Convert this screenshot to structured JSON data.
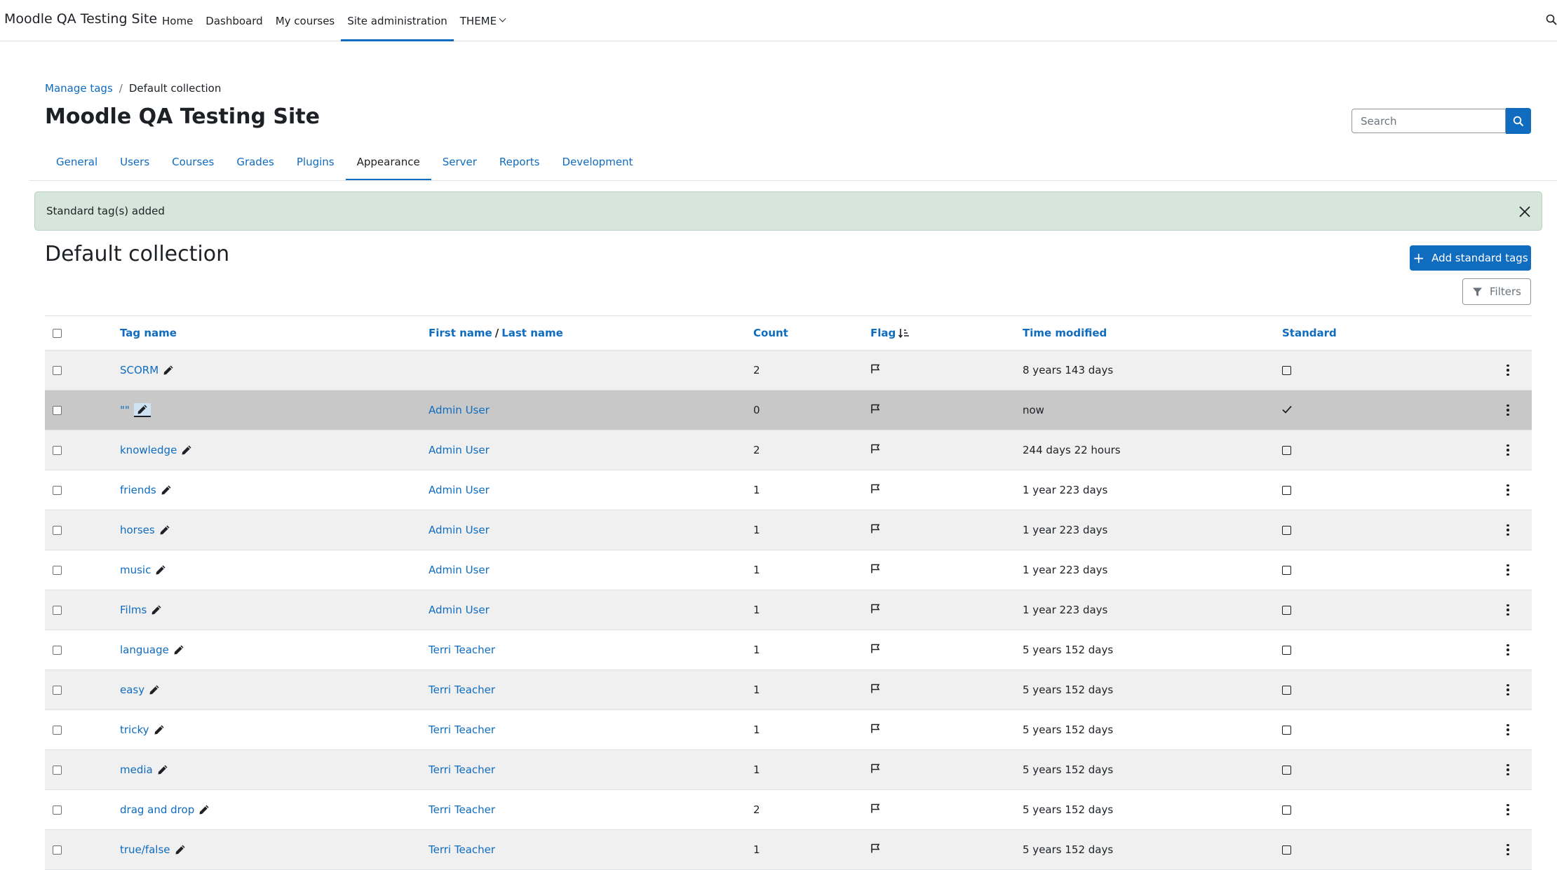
{
  "navbar": {
    "brand": "Moodle QA Testing Site",
    "items": [
      {
        "label": "Home",
        "active": false
      },
      {
        "label": "Dashboard",
        "active": false
      },
      {
        "label": "My courses",
        "active": false
      },
      {
        "label": "Site administration",
        "active": true
      },
      {
        "label": "THEME",
        "active": false,
        "dropdown": true
      }
    ]
  },
  "breadcrumb": {
    "link": "Manage tags",
    "separator": "/",
    "current": "Default collection"
  },
  "page_title": "Moodle QA Testing Site",
  "search": {
    "placeholder": "Search"
  },
  "tabs": [
    {
      "label": "General",
      "active": false
    },
    {
      "label": "Users",
      "active": false
    },
    {
      "label": "Courses",
      "active": false
    },
    {
      "label": "Grades",
      "active": false
    },
    {
      "label": "Plugins",
      "active": false
    },
    {
      "label": "Appearance",
      "active": true
    },
    {
      "label": "Server",
      "active": false
    },
    {
      "label": "Reports",
      "active": false
    },
    {
      "label": "Development",
      "active": false
    }
  ],
  "alert": {
    "message": "Standard tag(s) added"
  },
  "section_title": "Default collection",
  "add_button": {
    "label": "Add standard tags"
  },
  "filters_button": {
    "label": "Filters"
  },
  "table": {
    "headers": {
      "tag_name": "Tag name",
      "first_name": "First name",
      "slash": "/",
      "last_name": "Last name",
      "count": "Count",
      "flag": "Flag",
      "time_modified": "Time modified",
      "standard": "Standard"
    },
    "rows": [
      {
        "name": "SCORM",
        "user": "",
        "count": "2",
        "time": "8 years 143 days",
        "standard": false
      },
      {
        "name": "\"\"",
        "user": "Admin User",
        "count": "0",
        "time": "now",
        "standard": true
      },
      {
        "name": "knowledge",
        "user": "Admin User",
        "count": "2",
        "time": "244 days 22 hours",
        "standard": false
      },
      {
        "name": "friends",
        "user": "Admin User",
        "count": "1",
        "time": "1 year 223 days",
        "standard": false
      },
      {
        "name": "horses",
        "user": "Admin User",
        "count": "1",
        "time": "1 year 223 days",
        "standard": false
      },
      {
        "name": "music",
        "user": "Admin User",
        "count": "1",
        "time": "1 year 223 days",
        "standard": false
      },
      {
        "name": "Films",
        "user": "Admin User",
        "count": "1",
        "time": "1 year 223 days",
        "standard": false
      },
      {
        "name": "language",
        "user": "Terri Teacher",
        "count": "1",
        "time": "5 years 152 days",
        "standard": false
      },
      {
        "name": "easy",
        "user": "Terri Teacher",
        "count": "1",
        "time": "5 years 152 days",
        "standard": false
      },
      {
        "name": "tricky",
        "user": "Terri Teacher",
        "count": "1",
        "time": "5 years 152 days",
        "standard": false
      },
      {
        "name": "media",
        "user": "Terri Teacher",
        "count": "1",
        "time": "5 years 152 days",
        "standard": false
      },
      {
        "name": "drag and drop",
        "user": "Terri Teacher",
        "count": "2",
        "time": "5 years 152 days",
        "standard": false
      },
      {
        "name": "true/false",
        "user": "Terri Teacher",
        "count": "1",
        "time": "5 years 152 days",
        "standard": false
      }
    ]
  },
  "icons": {
    "search": "search-icon",
    "close": "close-icon",
    "plus": "plus-icon",
    "filter": "filter-icon",
    "pencil": "pencil-icon",
    "flag": "flag-icon",
    "sort": "sort-ascending-icon",
    "menu": "kebab-menu-icon",
    "check": "check-icon"
  },
  "colors": {
    "accent": "#0f6cbf",
    "alert_bg": "#d7e6dc",
    "highlight_row": "#c8c8c8",
    "striped_row": "#f0f0f0"
  }
}
